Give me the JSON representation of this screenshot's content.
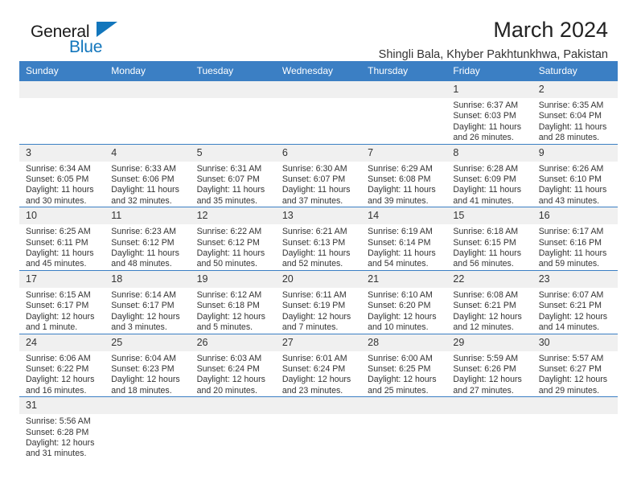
{
  "brand": {
    "name_dark": "General",
    "name_light": "Blue",
    "accent_color": "#1276bc"
  },
  "header": {
    "title": "March 2024",
    "subtitle": "Shingli Bala, Khyber Pakhtunkhwa, Pakistan"
  },
  "theme": {
    "header_bg": "#3b7fc4",
    "daynum_bg": "#f0f0f0",
    "text_color": "#333333"
  },
  "calendar": {
    "weekday_headers": [
      "Sunday",
      "Monday",
      "Tuesday",
      "Wednesday",
      "Thursday",
      "Friday",
      "Saturday"
    ],
    "weeks": [
      [
        {
          "day": "",
          "sunrise": "",
          "sunset": "",
          "daylight_line1": "",
          "daylight_line2": ""
        },
        {
          "day": "",
          "sunrise": "",
          "sunset": "",
          "daylight_line1": "",
          "daylight_line2": ""
        },
        {
          "day": "",
          "sunrise": "",
          "sunset": "",
          "daylight_line1": "",
          "daylight_line2": ""
        },
        {
          "day": "",
          "sunrise": "",
          "sunset": "",
          "daylight_line1": "",
          "daylight_line2": ""
        },
        {
          "day": "",
          "sunrise": "",
          "sunset": "",
          "daylight_line1": "",
          "daylight_line2": ""
        },
        {
          "day": "1",
          "sunrise": "Sunrise: 6:37 AM",
          "sunset": "Sunset: 6:03 PM",
          "daylight_line1": "Daylight: 11 hours",
          "daylight_line2": "and 26 minutes."
        },
        {
          "day": "2",
          "sunrise": "Sunrise: 6:35 AM",
          "sunset": "Sunset: 6:04 PM",
          "daylight_line1": "Daylight: 11 hours",
          "daylight_line2": "and 28 minutes."
        }
      ],
      [
        {
          "day": "3",
          "sunrise": "Sunrise: 6:34 AM",
          "sunset": "Sunset: 6:05 PM",
          "daylight_line1": "Daylight: 11 hours",
          "daylight_line2": "and 30 minutes."
        },
        {
          "day": "4",
          "sunrise": "Sunrise: 6:33 AM",
          "sunset": "Sunset: 6:06 PM",
          "daylight_line1": "Daylight: 11 hours",
          "daylight_line2": "and 32 minutes."
        },
        {
          "day": "5",
          "sunrise": "Sunrise: 6:31 AM",
          "sunset": "Sunset: 6:07 PM",
          "daylight_line1": "Daylight: 11 hours",
          "daylight_line2": "and 35 minutes."
        },
        {
          "day": "6",
          "sunrise": "Sunrise: 6:30 AM",
          "sunset": "Sunset: 6:07 PM",
          "daylight_line1": "Daylight: 11 hours",
          "daylight_line2": "and 37 minutes."
        },
        {
          "day": "7",
          "sunrise": "Sunrise: 6:29 AM",
          "sunset": "Sunset: 6:08 PM",
          "daylight_line1": "Daylight: 11 hours",
          "daylight_line2": "and 39 minutes."
        },
        {
          "day": "8",
          "sunrise": "Sunrise: 6:28 AM",
          "sunset": "Sunset: 6:09 PM",
          "daylight_line1": "Daylight: 11 hours",
          "daylight_line2": "and 41 minutes."
        },
        {
          "day": "9",
          "sunrise": "Sunrise: 6:26 AM",
          "sunset": "Sunset: 6:10 PM",
          "daylight_line1": "Daylight: 11 hours",
          "daylight_line2": "and 43 minutes."
        }
      ],
      [
        {
          "day": "10",
          "sunrise": "Sunrise: 6:25 AM",
          "sunset": "Sunset: 6:11 PM",
          "daylight_line1": "Daylight: 11 hours",
          "daylight_line2": "and 45 minutes."
        },
        {
          "day": "11",
          "sunrise": "Sunrise: 6:23 AM",
          "sunset": "Sunset: 6:12 PM",
          "daylight_line1": "Daylight: 11 hours",
          "daylight_line2": "and 48 minutes."
        },
        {
          "day": "12",
          "sunrise": "Sunrise: 6:22 AM",
          "sunset": "Sunset: 6:12 PM",
          "daylight_line1": "Daylight: 11 hours",
          "daylight_line2": "and 50 minutes."
        },
        {
          "day": "13",
          "sunrise": "Sunrise: 6:21 AM",
          "sunset": "Sunset: 6:13 PM",
          "daylight_line1": "Daylight: 11 hours",
          "daylight_line2": "and 52 minutes."
        },
        {
          "day": "14",
          "sunrise": "Sunrise: 6:19 AM",
          "sunset": "Sunset: 6:14 PM",
          "daylight_line1": "Daylight: 11 hours",
          "daylight_line2": "and 54 minutes."
        },
        {
          "day": "15",
          "sunrise": "Sunrise: 6:18 AM",
          "sunset": "Sunset: 6:15 PM",
          "daylight_line1": "Daylight: 11 hours",
          "daylight_line2": "and 56 minutes."
        },
        {
          "day": "16",
          "sunrise": "Sunrise: 6:17 AM",
          "sunset": "Sunset: 6:16 PM",
          "daylight_line1": "Daylight: 11 hours",
          "daylight_line2": "and 59 minutes."
        }
      ],
      [
        {
          "day": "17",
          "sunrise": "Sunrise: 6:15 AM",
          "sunset": "Sunset: 6:17 PM",
          "daylight_line1": "Daylight: 12 hours",
          "daylight_line2": "and 1 minute."
        },
        {
          "day": "18",
          "sunrise": "Sunrise: 6:14 AM",
          "sunset": "Sunset: 6:17 PM",
          "daylight_line1": "Daylight: 12 hours",
          "daylight_line2": "and 3 minutes."
        },
        {
          "day": "19",
          "sunrise": "Sunrise: 6:12 AM",
          "sunset": "Sunset: 6:18 PM",
          "daylight_line1": "Daylight: 12 hours",
          "daylight_line2": "and 5 minutes."
        },
        {
          "day": "20",
          "sunrise": "Sunrise: 6:11 AM",
          "sunset": "Sunset: 6:19 PM",
          "daylight_line1": "Daylight: 12 hours",
          "daylight_line2": "and 7 minutes."
        },
        {
          "day": "21",
          "sunrise": "Sunrise: 6:10 AM",
          "sunset": "Sunset: 6:20 PM",
          "daylight_line1": "Daylight: 12 hours",
          "daylight_line2": "and 10 minutes."
        },
        {
          "day": "22",
          "sunrise": "Sunrise: 6:08 AM",
          "sunset": "Sunset: 6:21 PM",
          "daylight_line1": "Daylight: 12 hours",
          "daylight_line2": "and 12 minutes."
        },
        {
          "day": "23",
          "sunrise": "Sunrise: 6:07 AM",
          "sunset": "Sunset: 6:21 PM",
          "daylight_line1": "Daylight: 12 hours",
          "daylight_line2": "and 14 minutes."
        }
      ],
      [
        {
          "day": "24",
          "sunrise": "Sunrise: 6:06 AM",
          "sunset": "Sunset: 6:22 PM",
          "daylight_line1": "Daylight: 12 hours",
          "daylight_line2": "and 16 minutes."
        },
        {
          "day": "25",
          "sunrise": "Sunrise: 6:04 AM",
          "sunset": "Sunset: 6:23 PM",
          "daylight_line1": "Daylight: 12 hours",
          "daylight_line2": "and 18 minutes."
        },
        {
          "day": "26",
          "sunrise": "Sunrise: 6:03 AM",
          "sunset": "Sunset: 6:24 PM",
          "daylight_line1": "Daylight: 12 hours",
          "daylight_line2": "and 20 minutes."
        },
        {
          "day": "27",
          "sunrise": "Sunrise: 6:01 AM",
          "sunset": "Sunset: 6:24 PM",
          "daylight_line1": "Daylight: 12 hours",
          "daylight_line2": "and 23 minutes."
        },
        {
          "day": "28",
          "sunrise": "Sunrise: 6:00 AM",
          "sunset": "Sunset: 6:25 PM",
          "daylight_line1": "Daylight: 12 hours",
          "daylight_line2": "and 25 minutes."
        },
        {
          "day": "29",
          "sunrise": "Sunrise: 5:59 AM",
          "sunset": "Sunset: 6:26 PM",
          "daylight_line1": "Daylight: 12 hours",
          "daylight_line2": "and 27 minutes."
        },
        {
          "day": "30",
          "sunrise": "Sunrise: 5:57 AM",
          "sunset": "Sunset: 6:27 PM",
          "daylight_line1": "Daylight: 12 hours",
          "daylight_line2": "and 29 minutes."
        }
      ],
      [
        {
          "day": "31",
          "sunrise": "Sunrise: 5:56 AM",
          "sunset": "Sunset: 6:28 PM",
          "daylight_line1": "Daylight: 12 hours",
          "daylight_line2": "and 31 minutes."
        },
        {
          "day": "",
          "sunrise": "",
          "sunset": "",
          "daylight_line1": "",
          "daylight_line2": ""
        },
        {
          "day": "",
          "sunrise": "",
          "sunset": "",
          "daylight_line1": "",
          "daylight_line2": ""
        },
        {
          "day": "",
          "sunrise": "",
          "sunset": "",
          "daylight_line1": "",
          "daylight_line2": ""
        },
        {
          "day": "",
          "sunrise": "",
          "sunset": "",
          "daylight_line1": "",
          "daylight_line2": ""
        },
        {
          "day": "",
          "sunrise": "",
          "sunset": "",
          "daylight_line1": "",
          "daylight_line2": ""
        },
        {
          "day": "",
          "sunrise": "",
          "sunset": "",
          "daylight_line1": "",
          "daylight_line2": ""
        }
      ]
    ]
  }
}
